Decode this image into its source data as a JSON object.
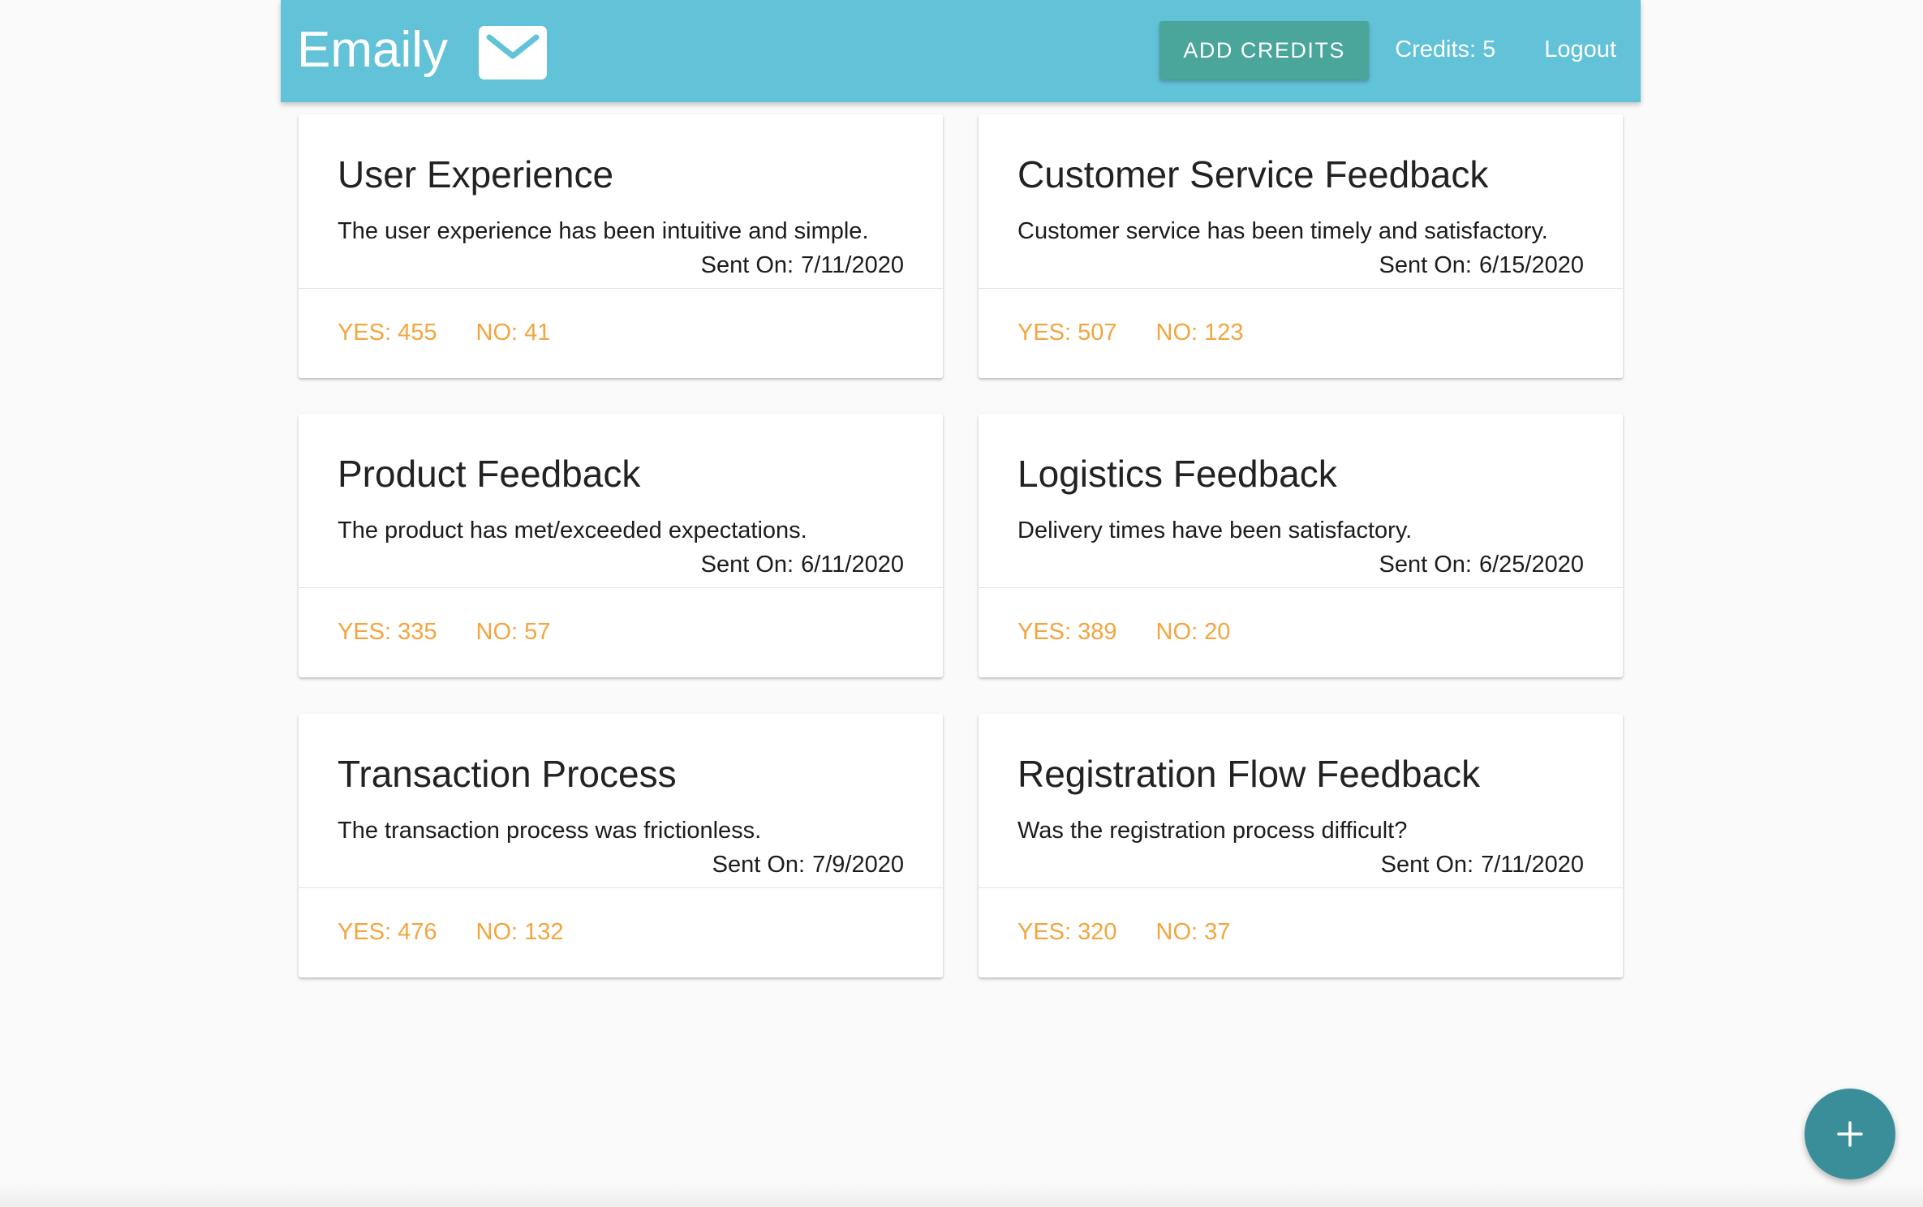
{
  "navbar": {
    "brand": "Emaily",
    "brand_icon": "envelope-icon",
    "add_credits_label": "Add Credits",
    "credits_label": "Credits: 5",
    "logout_label": "Logout",
    "background_color": "#62c2d8",
    "button_color": "#4aa59a"
  },
  "surveys": [
    {
      "title": "User Experience",
      "body": "The user experience has been intuitive and simple.",
      "sent_label": "Sent On:",
      "sent_date": "7/11/2020",
      "yes_label": "YES: 455",
      "no_label": "NO: 41"
    },
    {
      "title": "Customer Service Feedback",
      "body": "Customer service has been timely and satisfactory.",
      "sent_label": "Sent On:",
      "sent_date": "6/15/2020",
      "yes_label": "YES: 507",
      "no_label": "NO: 123"
    },
    {
      "title": "Product Feedback",
      "body": "The product has met/exceeded expectations.",
      "sent_label": "Sent On:",
      "sent_date": "6/11/2020",
      "yes_label": "YES: 335",
      "no_label": "NO: 57"
    },
    {
      "title": "Logistics Feedback",
      "body": "Delivery times have been satisfactory.",
      "sent_label": "Sent On:",
      "sent_date": "6/25/2020",
      "yes_label": "YES: 389",
      "no_label": "NO: 20"
    },
    {
      "title": "Transaction Process",
      "body": "The transaction process was frictionless.",
      "sent_label": "Sent On:",
      "sent_date": "7/9/2020",
      "yes_label": "YES: 476",
      "no_label": "NO: 132"
    },
    {
      "title": "Registration Flow Feedback",
      "body": "Was the registration process difficult?",
      "sent_label": "Sent On:",
      "sent_date": "7/11/2020",
      "yes_label": "YES: 320",
      "no_label": "NO: 37"
    }
  ],
  "fab": {
    "icon": "plus-icon",
    "color": "#3a8e99"
  },
  "accent_color": "#f3a53f"
}
